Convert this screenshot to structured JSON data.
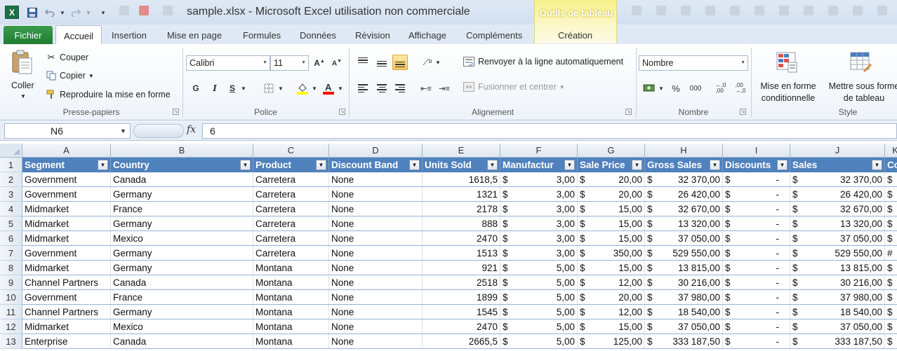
{
  "window": {
    "title": "sample.xlsx  -  Microsoft Excel utilisation non commerciale",
    "app_icon": "X",
    "contextual_group": "Outils de tableau"
  },
  "quick_access": {
    "save_icon": "save-icon",
    "undo_icon": "undo-icon",
    "redo_icon": "redo-icon"
  },
  "tabs": {
    "file": "Fichier",
    "items": [
      "Accueil",
      "Insertion",
      "Mise en page",
      "Formules",
      "Données",
      "Révision",
      "Affichage",
      "Compléments"
    ],
    "contextual": "Création",
    "active": "Accueil"
  },
  "ribbon": {
    "clipboard": {
      "paste": "Coller",
      "cut": "Couper",
      "copy": "Copier",
      "format_painter": "Reproduire la mise en forme",
      "label": "Presse-papiers"
    },
    "font": {
      "name": "Calibri",
      "size": "11",
      "bold": "G",
      "italic": "I",
      "underline": "S",
      "label": "Police",
      "fill_color": "#ffff00",
      "font_color": "#ff0000"
    },
    "alignment": {
      "wrap": "Renvoyer à la ligne automatiquement",
      "merge": "Fusionner et centrer",
      "label": "Alignement"
    },
    "number": {
      "format": "Nombre",
      "percent": "%",
      "thousands": "000",
      "inc_decimal": ",0\n,00",
      "dec_decimal": ",00\n,0",
      "label": "Nombre"
    },
    "style": {
      "conditional": "Mise en forme conditionnelle",
      "table_format": "Mettre sous forme de tableau",
      "label": "Style"
    }
  },
  "formula_bar": {
    "cell_ref": "N6",
    "fx": "fx",
    "value": "6"
  },
  "sheet": {
    "column_letters": [
      "A",
      "B",
      "C",
      "D",
      "E",
      "F",
      "G",
      "H",
      "I",
      "J",
      "K"
    ],
    "row_numbers": [
      "1",
      "2",
      "3",
      "4",
      "5",
      "6",
      "7",
      "8",
      "9",
      "10",
      "11",
      "12",
      "13"
    ],
    "headers": [
      "Segment",
      "Country",
      "Product",
      "Discount Band",
      "Units Sold",
      "Manufactur",
      "Sale Price",
      "Gross Sales",
      "Discounts",
      "Sales",
      "Co"
    ],
    "rows": [
      [
        "Government",
        "Canada",
        "Carretera",
        "None",
        "1618,5",
        "3,00",
        "20,00",
        "32 370,00",
        "-",
        "32 370,00",
        "$"
      ],
      [
        "Government",
        "Germany",
        "Carretera",
        "None",
        "1321",
        "3,00",
        "20,00",
        "26 420,00",
        "-",
        "26 420,00",
        "$"
      ],
      [
        "Midmarket",
        "France",
        "Carretera",
        "None",
        "2178",
        "3,00",
        "15,00",
        "32 670,00",
        "-",
        "32 670,00",
        "$"
      ],
      [
        "Midmarket",
        "Germany",
        "Carretera",
        "None",
        "888",
        "3,00",
        "15,00",
        "13 320,00",
        "-",
        "13 320,00",
        "$"
      ],
      [
        "Midmarket",
        "Mexico",
        "Carretera",
        "None",
        "2470",
        "3,00",
        "15,00",
        "37 050,00",
        "-",
        "37 050,00",
        "$"
      ],
      [
        "Government",
        "Germany",
        "Carretera",
        "None",
        "1513",
        "3,00",
        "350,00",
        "529 550,00",
        "-",
        "529 550,00",
        "#"
      ],
      [
        "Midmarket",
        "Germany",
        "Montana",
        "None",
        "921",
        "5,00",
        "15,00",
        "13 815,00",
        "-",
        "13 815,00",
        "$"
      ],
      [
        "Channel Partners",
        "Canada",
        "Montana",
        "None",
        "2518",
        "5,00",
        "12,00",
        "30 216,00",
        "-",
        "30 216,00",
        "$"
      ],
      [
        "Government",
        "France",
        "Montana",
        "None",
        "1899",
        "5,00",
        "20,00",
        "37 980,00",
        "-",
        "37 980,00",
        "$"
      ],
      [
        "Channel Partners",
        "Germany",
        "Montana",
        "None",
        "1545",
        "5,00",
        "12,00",
        "18 540,00",
        "-",
        "18 540,00",
        "$"
      ],
      [
        "Midmarket",
        "Mexico",
        "Montana",
        "None",
        "2470",
        "5,00",
        "15,00",
        "37 050,00",
        "-",
        "37 050,00",
        "$"
      ],
      [
        "Enterprise",
        "Canada",
        "Montana",
        "None",
        "2665,5",
        "5,00",
        "125,00",
        "333 187,50",
        "-",
        "333 187,50",
        "$"
      ]
    ],
    "currency_symbol": "$",
    "header_fill": "#4f81bd"
  }
}
